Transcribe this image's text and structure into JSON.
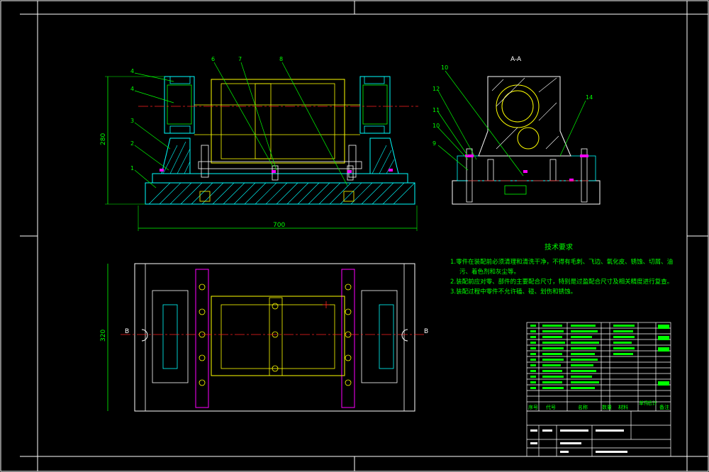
{
  "drawing": {
    "section_label": "A-A",
    "tech_req": {
      "title": "技术要求",
      "lines": [
        "1.零件在装配前必须清理和清洗干净，不得有毛刺、飞边、氧化皮、锈蚀、切屑、油",
        "污、着色剂和灰尘等。",
        "2.装配前应对零、部件的主要配合尺寸，特别是过盈配合尺寸及相关精度进行复查。",
        "3.装配过程中零件不允许磕、碰、划伤和锈蚀。"
      ]
    },
    "balloons_front": [
      "4",
      "4",
      "3",
      "2",
      "1",
      "6",
      "7",
      "8"
    ],
    "balloons_side": [
      "10",
      "12",
      "11",
      "10",
      "9",
      "14"
    ],
    "section_marks": [
      "B",
      "B"
    ],
    "dim_width": "700",
    "dim_height": "280",
    "dim_plan_height": "320",
    "bom_footer": [
      "序号",
      "代号",
      "名称",
      "数量",
      "材料",
      "单件",
      "总计",
      "备注"
    ]
  },
  "colors": {
    "background": "#000000",
    "frame": "#ffffff",
    "outline": "#ffff00",
    "hatch": "#00ffff",
    "dimension": "#00ff00",
    "centerline": "#ff2020",
    "text": "#00ff00",
    "bolt": "#ff00ff",
    "table": "#ffffff",
    "blue": "#3060ff"
  }
}
